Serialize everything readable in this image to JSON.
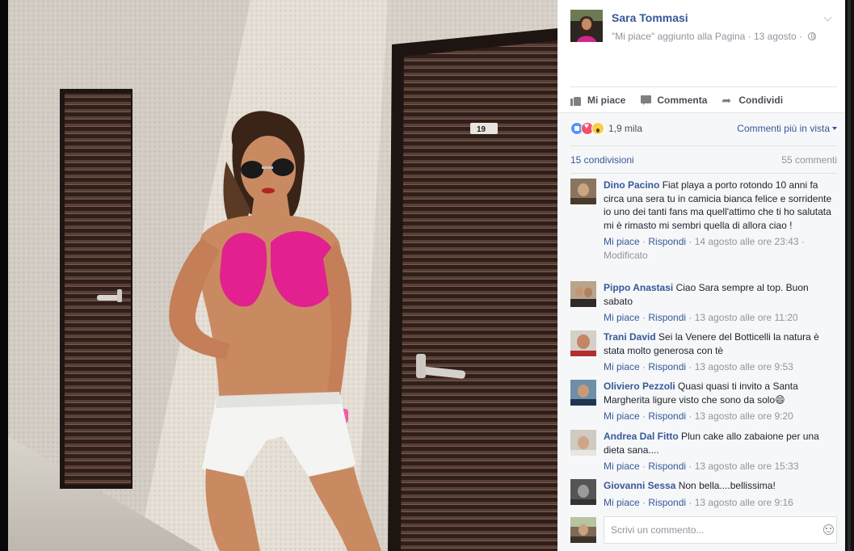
{
  "post": {
    "author": "Sara Tommasi",
    "meta": "\"Mi piace\" aggiunto alla Pagina · 13 agosto ·",
    "privacy_icon": "globe-icon"
  },
  "actions": {
    "like_label": "Mi piace",
    "comment_label": "Commenta",
    "share_label": "Condividi"
  },
  "reactions": {
    "count": "1,9 mila",
    "types": [
      "like",
      "love",
      "wow"
    ],
    "sort_label": "Commenti più in vista"
  },
  "stats": {
    "shares": "15 condivisioni",
    "comments": "55 commenti"
  },
  "comments": [
    {
      "author": "Dino Pacino",
      "text": "Fiat playa a porto rotondo 10 anni fa circa una sera tu in camicia bianca felice e sorridente io uno dei tanti fans ma quell'attimo che ti ho salutata mi è rimasto mi sembri quella di allora ciao !",
      "like": "Mi piace",
      "reply": "Rispondi",
      "time": "14 agosto alle ore 23:43",
      "edited": "Modificato"
    },
    {
      "author": "Pippo Anastasi",
      "text": "Ciao Sara sempre al top. Buon sabato",
      "like": "Mi piace",
      "reply": "Rispondi",
      "time": "13 agosto alle ore 11:20"
    },
    {
      "author": "Trani David",
      "text": "Sei la Venere del Botticelli la natura è stata molto generosa con tè",
      "like": "Mi piace",
      "reply": "Rispondi",
      "time": "13 agosto alle ore 9:53"
    },
    {
      "author": "Oliviero Pezzoli",
      "text": "Quasi quasi ti invito a Santa Margherita ligure visto che sono da solo😄",
      "like": "Mi piace",
      "reply": "Rispondi",
      "time": "13 agosto alle ore 9:20"
    },
    {
      "author": "Andrea Dal Fitto",
      "text": "Plun cake allo zabaione per una dieta sana....",
      "like": "Mi piace",
      "reply": "Rispondi",
      "time": "13 agosto alle ore 15:33"
    },
    {
      "author": "Giovanni Sessa",
      "text": "Non bella....bellissima!",
      "like": "Mi piace",
      "reply": "Rispondi",
      "time": "13 agosto alle ore 9:16"
    }
  ],
  "composer": {
    "placeholder": "Scrivi un commento..."
  },
  "photo": {
    "door_number": "19",
    "colors": {
      "wall": "#e4ded5",
      "door": "#3a2722",
      "bikini": "#e2208f",
      "shorts": "#f4f4f2",
      "skin": "#c98a62"
    }
  },
  "colors": {
    "link": "#365899",
    "muted": "#90949c",
    "ufi_bg": "#f6f7f9"
  }
}
